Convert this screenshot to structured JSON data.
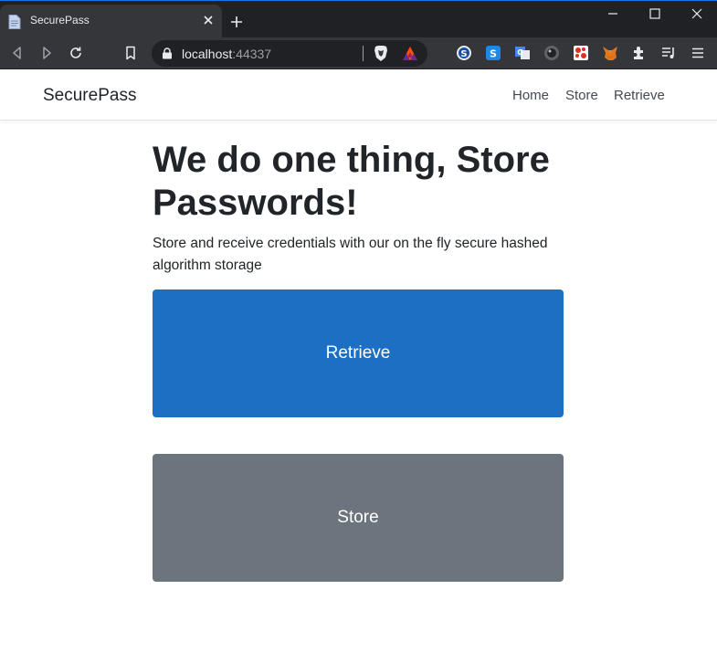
{
  "browser": {
    "tab_title": "SecurePass",
    "url_host": "localhost",
    "url_port": ":44337"
  },
  "navbar": {
    "brand": "SecurePass",
    "links": [
      "Home",
      "Store",
      "Retrieve"
    ]
  },
  "hero": {
    "headline_plain": "We do one thing, ",
    "headline_bold": "Store Passwords",
    "headline_end": "!",
    "lead": "Store and receive credentials with our on the fly secure hashed algorithm storage"
  },
  "actions": {
    "retrieve_label": "Retrieve",
    "store_label": "Store"
  },
  "colors": {
    "retrieve_button": "#1c6fc3",
    "store_button": "#6c757d",
    "chrome_dark": "#202124",
    "chrome_toolbar": "#35363a"
  }
}
